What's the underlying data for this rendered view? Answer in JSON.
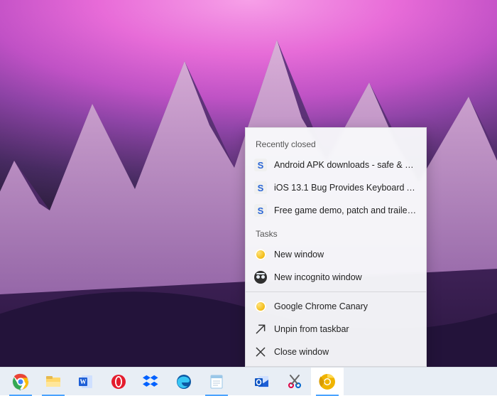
{
  "jumplist": {
    "sections": {
      "recent_header": "Recently closed",
      "tasks_header": "Tasks"
    },
    "recent": [
      {
        "label": "Android APK downloads - safe & verifi…"
      },
      {
        "label": "iOS 13.1 Bug Provides Keyboard Apps…"
      },
      {
        "label": "Free game demo, patch and trailer do…"
      }
    ],
    "tasks": [
      {
        "label": "New window"
      },
      {
        "label": "New incognito window"
      }
    ],
    "app": [
      {
        "label": "Google Chrome Canary"
      },
      {
        "label": "Unpin from taskbar"
      },
      {
        "label": "Close window"
      }
    ]
  },
  "taskbar": {
    "items": [
      {
        "name": "chrome",
        "running": true
      },
      {
        "name": "file-explorer",
        "running": true
      },
      {
        "name": "word",
        "running": false
      },
      {
        "name": "opera",
        "running": false
      },
      {
        "name": "dropbox",
        "running": false
      },
      {
        "name": "edge",
        "running": false
      },
      {
        "name": "notepad",
        "running": true
      },
      {
        "name": "outlook",
        "running": false
      },
      {
        "name": "snipping-tool",
        "running": false
      },
      {
        "name": "chrome-canary",
        "running": true,
        "active": true
      }
    ]
  }
}
